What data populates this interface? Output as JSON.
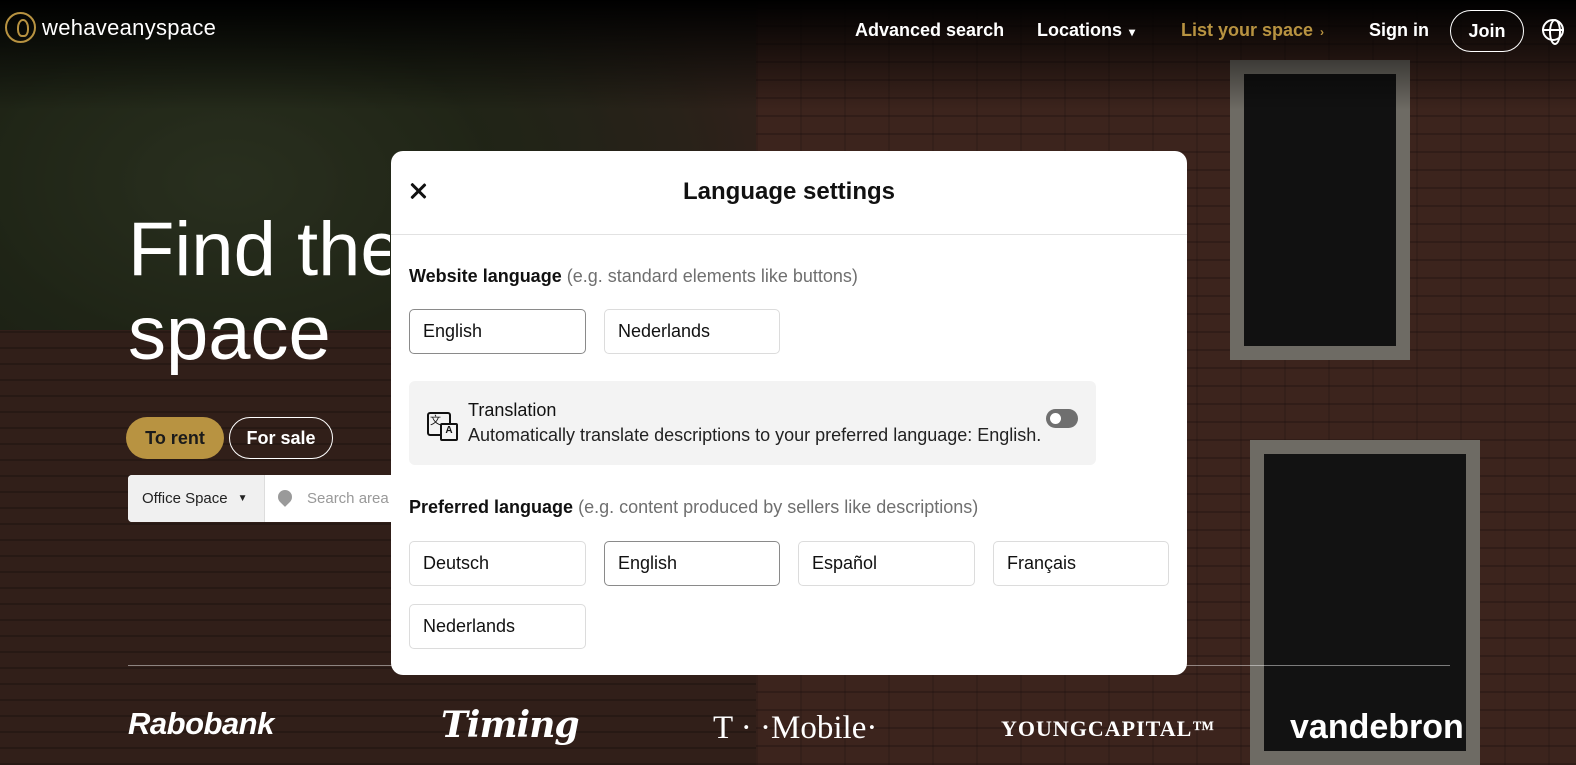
{
  "header": {
    "logo_text": "wehaveanyspace",
    "nav": {
      "advanced_search": "Advanced search",
      "locations": "Locations",
      "list_space": "List your space",
      "sign_in": "Sign in",
      "join": "Join"
    }
  },
  "hero": {
    "title_line1": "Find the",
    "title_line2": "space",
    "tabs": [
      "To rent",
      "For sale"
    ],
    "search": {
      "type_value": "Office Space",
      "area_placeholder": "Search area"
    },
    "partners": [
      "Rabobank",
      "Timing",
      "T · ·Mobile·",
      "YOUNGCAPITAL™",
      "vandebron"
    ]
  },
  "modal": {
    "title": "Language settings",
    "website_language": {
      "label": "Website language",
      "hint": "(e.g. standard elements like buttons)",
      "options": [
        "English",
        "Nederlands"
      ],
      "selected": "English"
    },
    "translation": {
      "title": "Translation",
      "description": "Automatically translate descriptions to your preferred language: English.",
      "enabled": false
    },
    "preferred_language": {
      "label": "Preferred language",
      "hint": "(e.g. content produced by sellers like descriptions)",
      "options": [
        "Deutsch",
        "English",
        "Español",
        "Français",
        "Nederlands"
      ],
      "selected": "English"
    }
  },
  "colors": {
    "accent": "#b89341",
    "overlay": "#000000",
    "toggle_off": "#6f6f6f"
  },
  "icons": {
    "logo": "logo-mark-icon",
    "locations": "chevron-down-icon",
    "list_space": "chevron-right-icon",
    "language": "globe-icon",
    "close": "close-icon",
    "search_type": "caret-down-icon",
    "search_area": "map-pin-icon",
    "translation": "translate-icon"
  }
}
